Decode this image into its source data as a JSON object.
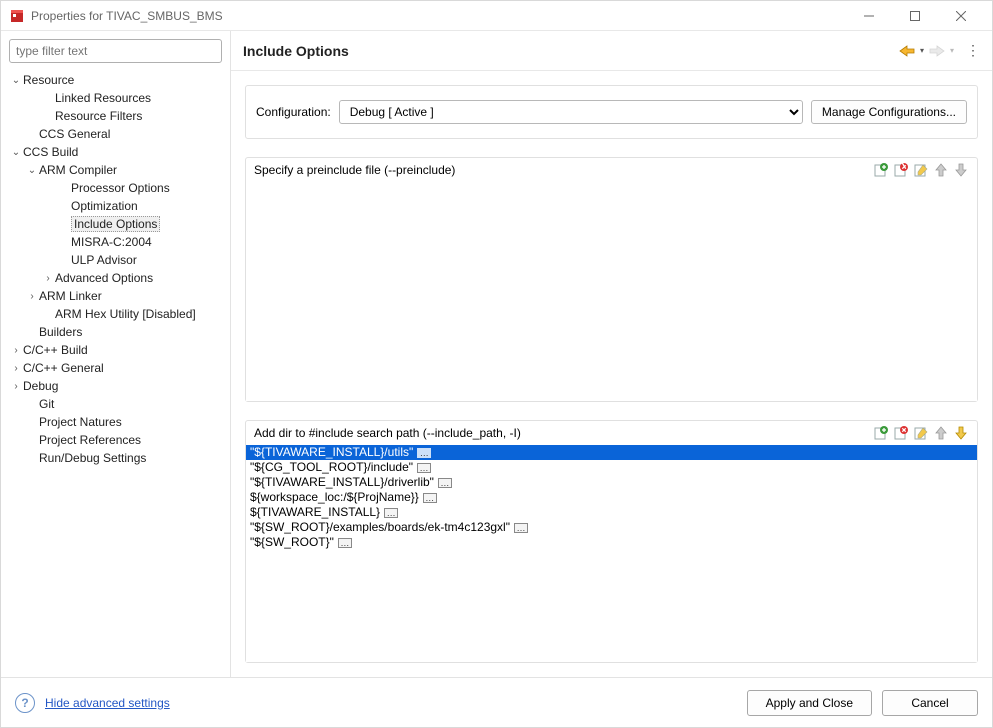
{
  "window": {
    "title": "Properties for TIVAC_SMBUS_BMS"
  },
  "sidebar": {
    "filter_placeholder": "type filter text",
    "items": {
      "resource": "Resource",
      "linked_resources": "Linked Resources",
      "resource_filters": "Resource Filters",
      "ccs_general": "CCS General",
      "ccs_build": "CCS Build",
      "arm_compiler": "ARM Compiler",
      "processor_options": "Processor Options",
      "optimization": "Optimization",
      "include_options": "Include Options",
      "misra": "MISRA-C:2004",
      "ulp": "ULP Advisor",
      "advanced_options": "Advanced Options",
      "arm_linker": "ARM Linker",
      "arm_hex": "ARM Hex Utility  [Disabled]",
      "builders": "Builders",
      "ccpp_build": "C/C++ Build",
      "ccpp_general": "C/C++ General",
      "debug": "Debug",
      "git": "Git",
      "project_natures": "Project Natures",
      "project_references": "Project References",
      "run_debug": "Run/Debug Settings"
    }
  },
  "content": {
    "heading": "Include Options",
    "config_label": "Configuration:",
    "config_value": "Debug  [ Active ]",
    "manage_button": "Manage Configurations..."
  },
  "preinclude": {
    "label": "Specify a preinclude file (--preinclude)",
    "items": []
  },
  "includepath": {
    "label": "Add dir to #include search path (--include_path, -I)",
    "items": [
      "\"${TIVAWARE_INSTALL}/utils\"",
      "\"${CG_TOOL_ROOT}/include\"",
      "\"${TIVAWARE_INSTALL}/driverlib\"",
      "${workspace_loc:/${ProjName}}",
      "${TIVAWARE_INSTALL}",
      "\"${SW_ROOT}/examples/boards/ek-tm4c123gxl\"",
      "\"${SW_ROOT}\""
    ],
    "selected_index": 0
  },
  "footer": {
    "hide_link": "Hide advanced settings",
    "apply": "Apply and Close",
    "cancel": "Cancel"
  }
}
